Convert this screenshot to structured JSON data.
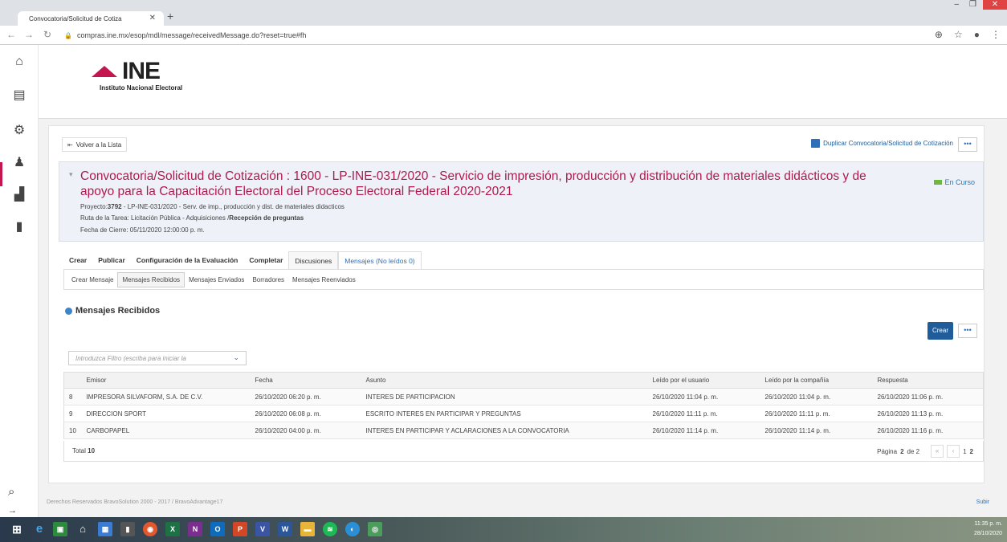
{
  "browser": {
    "tab_title": "Convocatoria/Solicitud de Cotiza",
    "url": "compras.ine.mx/esop/mdl/message/receivedMessage.do?reset=true#fh"
  },
  "logo": {
    "name": "INE",
    "subtitle": "Instituto Nacional Electoral"
  },
  "actions": {
    "back_label": "Volver a la Lista",
    "duplicate_label": "Duplicar Convocatoria/Solicitud de Cotización",
    "more_label": "•••"
  },
  "summary": {
    "title": "Convocatoria/Solicitud de Cotización : 1600 - LP-INE-031/2020 - Servicio de impresión, producción y distribución de materiales didácticos y de apoyo para la Capacitación Electoral del Proceso Electoral Federal 2020-2021",
    "project_label": "Proyecto:",
    "project_id": "3792",
    "project_desc": "- LP-INE-031/2020 - Serv. de imp., producción y dist. de materiales didacticos",
    "route_label": "Ruta de la Tarea: Licitación Pública - Adquisiciones /",
    "route_stage": "Recepción de preguntas",
    "close_date": "Fecha de Cierre: 05/11/2020 12:00:00 p. m.",
    "status": "En Curso"
  },
  "tabs": [
    {
      "label": "Crear"
    },
    {
      "label": "Publicar"
    },
    {
      "label": "Configuración de la Evaluación"
    },
    {
      "label": "Completar"
    },
    {
      "label": "Discusiones"
    },
    {
      "label": "Mensajes (No leídos 0)"
    }
  ],
  "subtabs": [
    {
      "label": "Crear Mensaje"
    },
    {
      "label": "Mensajes Recibidos"
    },
    {
      "label": "Mensajes Enviados"
    },
    {
      "label": "Borradores"
    },
    {
      "label": "Mensajes Reenviados"
    }
  ],
  "section_title": "Mensajes Recibidos",
  "create_label": "Crear",
  "filter_placeholder": "Introduzca Filtro (escriba para iniciar la",
  "table": {
    "headers": [
      "Emisor",
      "Fecha",
      "Asunto",
      "Leído por el usuario",
      "Leído por la compañía",
      "Respuesta"
    ],
    "rows": [
      {
        "n": "8",
        "emisor": "IMPRESORA SILVAFORM, S.A. DE C.V.",
        "fecha": "26/10/2020 06:20 p. m.",
        "asunto": "INTERES DE PARTICIPACION",
        "leido_usuario": "26/10/2020 11:04 p. m.",
        "leido_compania": "26/10/2020 11:04 p. m.",
        "respuesta": "26/10/2020 11:06 p. m."
      },
      {
        "n": "9",
        "emisor": "DIRECCION SPORT",
        "fecha": "26/10/2020 06:08 p. m.",
        "asunto": "ESCRITO INTERES EN PARTICIPAR Y PREGUNTAS",
        "leido_usuario": "26/10/2020 11:11 p. m.",
        "leido_compania": "26/10/2020 11:11 p. m.",
        "respuesta": "26/10/2020 11:13 p. m."
      },
      {
        "n": "10",
        "emisor": "CARBOPAPEL",
        "fecha": "26/10/2020 04:00 p. m.",
        "asunto": "INTERES EN PARTICIPAR Y ACLARACIONES A LA CONVOCATORIA",
        "leido_usuario": "26/10/2020 11:14 p. m.",
        "leido_compania": "26/10/2020 11:14 p. m.",
        "respuesta": "26/10/2020 11:16 p. m."
      }
    ],
    "total_label": "Total",
    "total_value": "10",
    "page_label": "Página",
    "page_current": "2",
    "page_of": "de 2",
    "page_links": [
      "1",
      "2"
    ]
  },
  "footer": {
    "copyright": "Derechos Reservados BravoSolution 2000 - 2017 / BravoAdvantage17",
    "top_link": "Subir"
  },
  "taskbar": {
    "time": "11:35 p. m.",
    "date": "28/10/2020"
  },
  "colors": {
    "brand": "#c4154f",
    "primary": "#1f5c99",
    "status_green": "#6fb83f"
  }
}
